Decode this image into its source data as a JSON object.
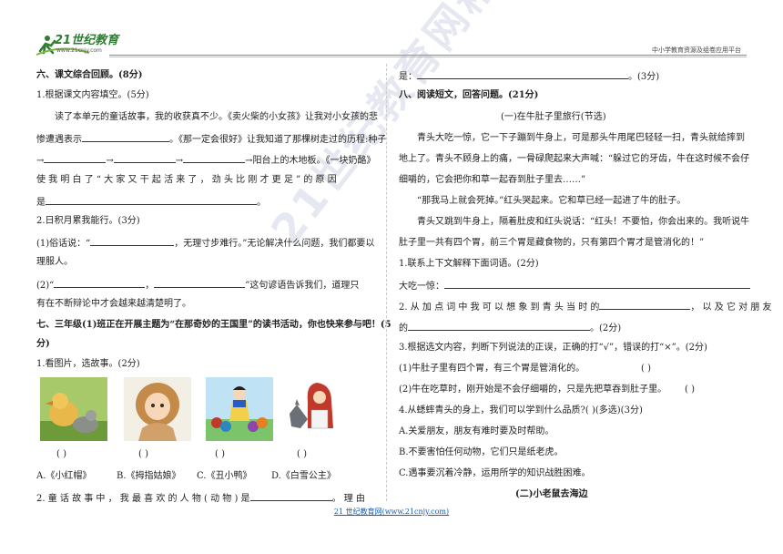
{
  "header": {
    "logo_text": "21世纪教育",
    "logo_sub": "www.21cnjy.com",
    "right_text": "中小学教育资源及组卷应用平台"
  },
  "left": {
    "s6_title": "六、课文综合回顾。(8分)",
    "q1": "1.根据课文内容填空。(5分)",
    "q1_l1": "读了本单元的童话故事，我的收获真不少。《卖火柴的小女孩》让我对小女孩的悲",
    "q1_l2a": "惨遭遇表示",
    "q1_l2b": "。《那一定会很好》让我知道了那棵树走过的历程:种子",
    "q1_l3_arrow1": "→",
    "q1_l3_arrow2": "→",
    "q1_l3_arrow3": "→",
    "q1_l3_end": "→阳台上的木地板。《一块奶酪》",
    "q1_l4": "使 我 明 白 了 “ 大 家 又 干 起 活 来 了 ， 劲 头 比 刚 才 更 足 ” 的 原 因",
    "q1_l5": "是",
    "q1_l5_end": "。",
    "q2": "2.日积月累我能行。(3分)",
    "q2_1a": "(1)俗话说：“",
    "q2_1b": "，无理寸步难行。”无论解决什么问题，我们都要以",
    "q2_1c": "理服人。",
    "q2_2a": "(2)“",
    "q2_2b": "，",
    "q2_2c": "”这句谚语告诉我们，道理只",
    "q2_2d": "有在不断辩论中才会越来越清楚明了。",
    "s7_title_1": "七、三年级(1)班正在开展主题为“在那奇妙的王国里”的读书活动，你也快来参与吧！(5",
    "s7_title_2": "分)",
    "q7_1": "1.看图片，选故事。(2分)",
    "pic_brackets": [
      "(        )",
      "(        )",
      "(        )",
      "(        )"
    ],
    "options": [
      "A.《小红帽》",
      "B.《拇指姑娘》",
      "C.《丑小鸭》",
      "D.《白雪公主》"
    ],
    "q7_2a": "2. 童 话 故 事 中 ， 我 最 喜 欢 的 人 物 ( 动 物 ) 是",
    "q7_2b": "。 理 由"
  },
  "right": {
    "cont_a": "是：",
    "cont_b": "。(3分)",
    "s8_title": "八、阅读短文，回答问题。(21分)",
    "sub1": "(一)在牛肚子里旅行(节选)",
    "p1_1": "青头大吃一惊，它一下子蹦到牛身上，可是那头牛用尾巴轻轻一扫，青头就给摔到",
    "p1_2": "地上了。青头不顾身上的痛，一骨碌爬起来大声喊：“躲过它的牙齿，牛在这时候不会仔",
    "p1_3": "细嚼的，它会把你和草一起吞到肚子里去……”",
    "p2": "“那我马上就会死掉。”红头哭起来。它和草已经一起进了牛的肚子。",
    "p3_1": "青头又跳到牛身上，隔着肚皮和红头说话：“红头！不要怕，你会出来的。我听说牛",
    "p3_2": "肚子里一共有四个胃，前三个胃是藏食物的，只有第四个胃才是管消化的！”",
    "r1": "1.联系上下文解释下面词语。(2分)",
    "r1_word": "大吃一惊：",
    "r2a": "2. 从 加 点 词 中 我 可 以 想 象 到 青 头 当 时 的",
    "r2b": "， 以 及 它 对 朋 友",
    "r2c": "的",
    "r2d": "。(2分)",
    "r3": "3.根据选文内容，判断下列说法的正误，正确的打“√”，错误的打“×”。(2分)",
    "r3_1": "(1)牛肚子里有四个胃，有三个胃是管消化的。",
    "r3_1b": "(        )",
    "r3_2": "(2)牛在吃草时，刚开始是不会仔细嚼的，只是先把草吞到肚子里。",
    "r3_2b": "(        )",
    "r4": "4.从蟋蟀青头的身上，我们可以学到什么品质?(      )(多选)(3分)",
    "r4_a": "A.关爱朋友，朋友有难时要及时帮助。",
    "r4_b": "B.不要害怕任何动物，它们只是纸老虎。",
    "r4_c": "C.遇事要沉着冷静，运用所学的知识战胜困难。",
    "sub2": "(二)小老鼠去海边"
  },
  "watermark": "21世纪教育网精选资料",
  "footer": "21 世纪教育网(www.21cnjy.com)",
  "colors": {
    "link": "#1a5fb4",
    "logo_green": "#2e7d32"
  }
}
